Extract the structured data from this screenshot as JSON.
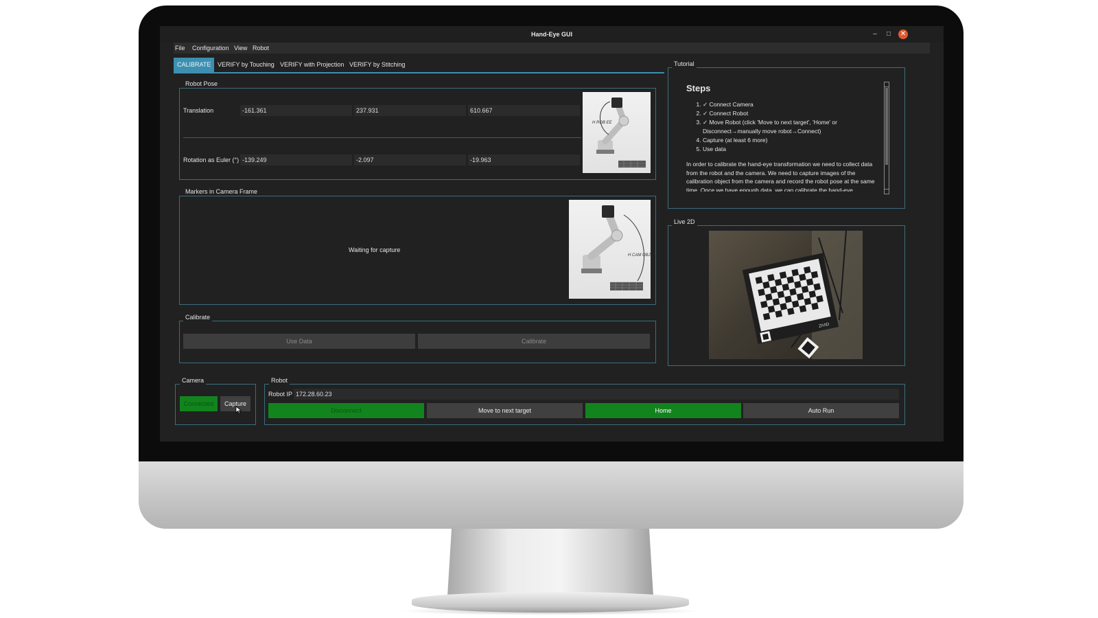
{
  "window": {
    "title": "Hand-Eye GUI",
    "minimize": "–",
    "maximize": "□",
    "close": "✕"
  },
  "menu": [
    "File",
    "Configuration",
    "View",
    "Robot"
  ],
  "tabs": [
    "CALIBRATE",
    "VERIFY by Touching",
    "VERIFY with Projection",
    "VERIFY by Stitching"
  ],
  "robot_pose": {
    "group_label": "Robot Pose",
    "translation_label": "Translation",
    "translation": [
      "-161.361",
      "237.931",
      "610.667"
    ],
    "rotation_label": "Rotation as Euler (°)",
    "rotation": [
      "-139.249",
      "-2.097",
      "-19.963"
    ],
    "image_label": "H ROB EE"
  },
  "markers": {
    "group_label": "Markers in Camera Frame",
    "status": "Waiting for capture",
    "image_label": "H CAM OBJ"
  },
  "calibrate": {
    "group_label": "Calibrate",
    "use_data": "Use Data",
    "calibrate": "Calibrate"
  },
  "camera": {
    "group_label": "Camera",
    "connected": "Connected",
    "capture": "Capture"
  },
  "robot": {
    "group_label": "Robot",
    "ip_label": "Robot IP",
    "ip_value": "172.28.60.23",
    "disconnect": "Disconnect",
    "move_next": "Move to next target",
    "home": "Home",
    "auto_run": "Auto Run"
  },
  "tutorial": {
    "group_label": "Tutorial",
    "heading": "Steps",
    "steps": [
      "✓ Connect Camera",
      "✓ Connect Robot",
      "✓ Move Robot (click 'Move to next target', 'Home' or Disconnect→manually move robot→Connect)",
      "Capture (at least 6 more)",
      "Use data"
    ],
    "paragraph": "In order to calibrate the hand-eye transformation we need to collect data from the robot and the camera. We need to capture images of the calibration object from the camera and record the robot pose at the same time. Once we have enough data, we can calibrate the hand-eye"
  },
  "live2d": {
    "group_label": "Live 2D",
    "board_brand": "ZIVID"
  },
  "colors": {
    "accent": "#3d8fb0",
    "green": "#12841e",
    "background": "#212121",
    "border": "#3c6e7e"
  },
  "icons": [
    "minimize-icon",
    "maximize-icon",
    "close-icon",
    "scroll-up-icon",
    "scroll-down-icon",
    "mouse-cursor-icon"
  ]
}
